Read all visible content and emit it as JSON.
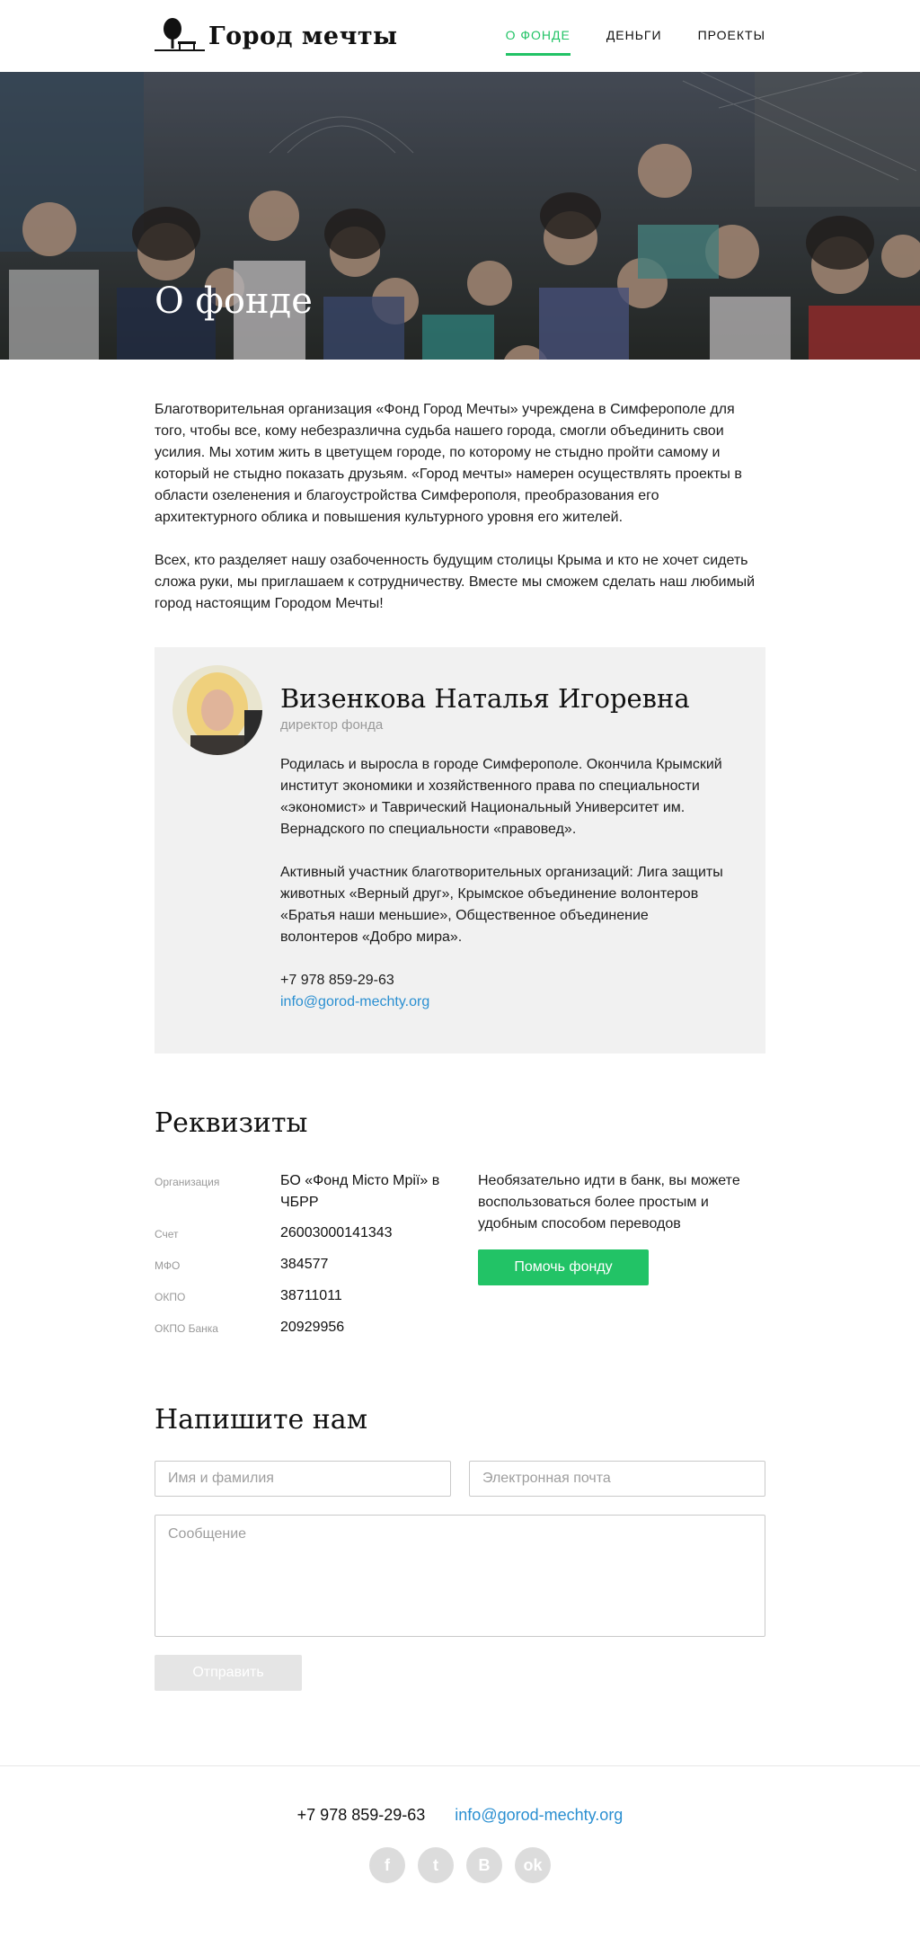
{
  "brand": {
    "name": "Город мечты"
  },
  "nav": {
    "items": [
      {
        "label": "О ФОНДЕ",
        "active": true
      },
      {
        "label": "ДЕНЬГИ",
        "active": false
      },
      {
        "label": "ПРОЕКТЫ",
        "active": false
      }
    ]
  },
  "hero": {
    "title": "О фонде"
  },
  "intro": {
    "paragraphs": [
      "Благотворительная организация «Фонд Город Мечты» учреждена в Симферополе для того, чтобы все, кому небезразлична судьба нашего города, смогли объединить свои усилия. Мы хотим жить в цветущем городе, по которому не стыдно пройти самому и который не стыдно показать друзьям. «Город мечты» намерен осуществлять проекты в области озеленения и благоустройства Симферополя, преобразования его архитектурного облика и повышения культурного уровня его жителей.",
      "Всех, кто разделяет нашу озабоченность будущим столицы Крыма и кто не хочет сидеть сложа руки, мы приглашаем к сотрудничеству. Вместе мы сможем сделать наш любимый город настоящим Городом Мечты!"
    ]
  },
  "director": {
    "name": "Визенкова Наталья Игоревна",
    "role": "директор фонда",
    "bio": [
      "Родилась и выросла в городе Симферополе. Окончила Крымский институт экономики и хозяйственного права по специальности «экономист» и Таврический Национальный Университет им. Вернадского по специальности «правовед».",
      "Активный участник благотворительных организаций: Лига защиты животных «Верный друг», Крымское объединение волонтеров «Братья наши меньшие», Общественное объединение волонтеров «Добро мира»."
    ],
    "phone": "+7 978 859-29-63",
    "email": "info@gorod-mechty.org"
  },
  "requisites": {
    "title": "Реквизиты",
    "rows": [
      {
        "label": "Организация",
        "value": "БО «Фонд Місто Мрії» в ЧБРР"
      },
      {
        "label": "Счет",
        "value": "26003000141343"
      },
      {
        "label": "МФО",
        "value": "384577"
      },
      {
        "label": "ОКПО",
        "value": "38711011"
      },
      {
        "label": "ОКПО Банка",
        "value": "20929956"
      }
    ],
    "side_text": "Необязательно идти в банк, вы можете воспользоваться более простым и удобным способом переводов",
    "help_button": "Помочь фонду"
  },
  "contact": {
    "title": "Напишите нам",
    "name_placeholder": "Имя и фамилия",
    "email_placeholder": "Электронная почта",
    "message_placeholder": "Сообщение",
    "submit_label": "Отправить"
  },
  "footer": {
    "phone": "+7 978 859-29-63",
    "email": "info@gorod-mechty.org",
    "socials": [
      {
        "name": "facebook-icon",
        "glyph": "f"
      },
      {
        "name": "twitter-icon",
        "glyph": "t"
      },
      {
        "name": "vk-icon",
        "glyph": "B"
      },
      {
        "name": "odnoklassniki-icon",
        "glyph": "ok"
      }
    ]
  },
  "colors": {
    "accent": "#22c366",
    "link": "#2a8fd1",
    "card_bg": "#f1f1f1",
    "muted": "#999999"
  }
}
